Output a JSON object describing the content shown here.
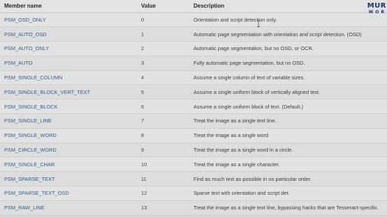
{
  "table": {
    "headers": {
      "member": "Member name",
      "value": "Value",
      "description": "Description"
    },
    "rows": [
      {
        "member": "PSM_OSD_ONLY",
        "value": "0",
        "description": "Orientation and script detection only."
      },
      {
        "member": "PSM_AUTO_OSD",
        "value": "1",
        "description": "Automatic page segmentation with orientation and script detection. (OSD)"
      },
      {
        "member": "PSM_AUTO_ONLY",
        "value": "2",
        "description": "Automatic page segmentation, but no OSD, or OCR."
      },
      {
        "member": "PSM_AUTO",
        "value": "3",
        "description": "Fully automatic page segmentation, but no OSD."
      },
      {
        "member": "PSM_SINGLE_COLUMN",
        "value": "4",
        "description": "Assume a single column of text of variable sizes."
      },
      {
        "member": "PSM_SINGLE_BLOCK_VERT_TEXT",
        "value": "5",
        "description": "Assume a single uniform block of vertically aligned text."
      },
      {
        "member": "PSM_SINGLE_BLOCK",
        "value": "6",
        "description": "Assume a single uniform block of text. (Default.)"
      },
      {
        "member": "PSM_SINGLE_LINE",
        "value": "7",
        "description": "Treat the image as a single text line."
      },
      {
        "member": "PSM_SINGLE_WORD",
        "value": "8",
        "description": "Treat the image as a single word."
      },
      {
        "member": "PSM_CIRCLE_WORD",
        "value": "9",
        "description": "Treat the image as a single word in a circle."
      },
      {
        "member": "PSM_SINGLE_CHAR",
        "value": "10",
        "description": "Treat the image as a single character."
      },
      {
        "member": "PSM_SPARSE_TEXT",
        "value": "11",
        "description": "Find as much text as possible in no particular order."
      },
      {
        "member": "PSM_SPARSE_TEXT_OSD",
        "value": "12",
        "description": "Sparse text with orientation and script det."
      },
      {
        "member": "PSM_RAW_LINE",
        "value": "13",
        "description": "Treat the image as a single text line, bypassing hacks that are Tesseract-specific."
      }
    ]
  },
  "logo": {
    "line1": "MUR",
    "line2": "WOR"
  },
  "colors": {
    "member_link": "#2f5f8f",
    "logo": "#1e2f6e"
  }
}
